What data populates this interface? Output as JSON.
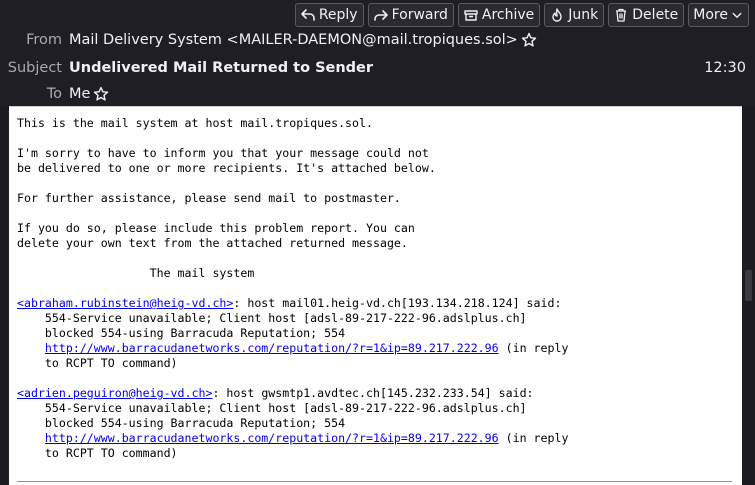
{
  "toolbar": {
    "reply": "Reply",
    "forward": "Forward",
    "archive": "Archive",
    "junk": "Junk",
    "delete": "Delete",
    "more": "More"
  },
  "header": {
    "from_label": "From",
    "from_value": "Mail Delivery System <MAILER-DAEMON@mail.tropiques.sol>",
    "subject_label": "Subject",
    "subject_value": "Undelivered Mail Returned to Sender",
    "to_label": "To",
    "to_value": "Me",
    "time": "12:30"
  },
  "message": {
    "p1": "This is the mail system at host mail.tropiques.sol.",
    "p2": "I'm sorry to have to inform you that your message could not\nbe delivered to one or more recipients. It's attached below.",
    "p3": "For further assistance, please send mail to postmaster.",
    "p4": "If you do so, please include this problem report. You can\ndelete your own text from the attached returned message.",
    "p5": "                   The mail system",
    "reports": [
      {
        "recipient": "<abraham.rubinstein@heig-vd.ch>",
        "line1": ": host mail01.heig-vd.ch[193.134.218.124] said:",
        "line2": "    554-Service unavailable; Client host [adsl-89-217-222-96.adslplus.ch]\n    blocked 554-using Barracuda Reputation; 554\n    ",
        "url": "http://www.barracudanetworks.com/reputation/?r=1&ip=89.217.222.96",
        "line3": " (in reply\n    to RCPT TO command)"
      },
      {
        "recipient": "<adrien.peguiron@heig-vd.ch>",
        "line1": ": host gwsmtp1.avdtec.ch[145.232.233.54] said:",
        "line2": "    554-Service unavailable; Client host [adsl-89-217-222-96.adslplus.ch]\n    blocked 554-using Barracuda Reputation; 554\n    ",
        "url": "http://www.barracudanetworks.com/reputation/?r=1&ip=89.217.222.96",
        "line3": " (in reply\n    to RCPT TO command)"
      }
    ]
  },
  "colors": {
    "header_bg": "#1f1e25",
    "button_bg": "#2b2a33",
    "link": "#0000ee",
    "body_bg": "#ffffff"
  }
}
